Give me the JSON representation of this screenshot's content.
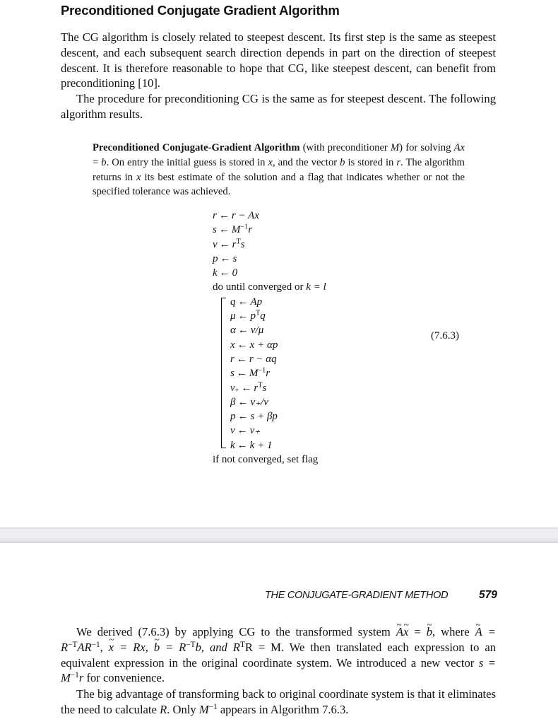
{
  "page_top": {
    "heading": "Preconditioned Conjugate Gradient Algorithm",
    "para1": {
      "text": "The CG algorithm is closely related to steepest descent.  Its first step is the same as steepest descent, and each subsequent search direction depends in part on the direction of steepest descent. It is therefore reasonable to hope that CG, like steepest descent, can benefit from preconditioning [10]."
    },
    "para2": {
      "text": "The procedure for preconditioning CG is the same as for steepest descent.  The following algorithm results."
    },
    "algorithm_box": {
      "title": "Preconditioned Conjugate-Gradient Algorithm",
      "t1": " (with preconditioner ",
      "M": "M",
      "t2": ") for solving ",
      "Ax": "Ax",
      "eq": " = ",
      "b": "b",
      "t3": ". On entry the initial guess is stored in ",
      "x": "x",
      "t4": ", and the vector ",
      "b2": "b",
      "t5": " is stored in ",
      "r": "r",
      "t6": ". The algorithm returns in ",
      "x2": "x",
      "t7": " its best estimate of the solution and a flag that indicates whether or not the specified tolerance was achieved."
    },
    "algorithm": {
      "arrow": "←",
      "init": [
        {
          "lhs": "r",
          "rhs": "r − Ax"
        },
        {
          "lhs": "s",
          "rhs_base": "M",
          "rhs_sup": "−1",
          "rhs_tail": "r"
        },
        {
          "lhs": "ν",
          "rhs_base": "r",
          "rhs_sup": "T",
          "rhs_tail": "s"
        },
        {
          "lhs": "p",
          "rhs": "s"
        },
        {
          "lhs": "k",
          "rhs": "0"
        }
      ],
      "loop_header": "do until converged or ",
      "loop_condition": "k = l",
      "loop": [
        {
          "lhs": "q",
          "rhs": "Ap"
        },
        {
          "lhs": "μ",
          "rhs_base": "p",
          "rhs_sup": "T",
          "rhs_tail": "q"
        },
        {
          "lhs": "α",
          "rhs": "ν/μ"
        },
        {
          "lhs": "x",
          "rhs": "x + αp"
        },
        {
          "lhs": "r",
          "rhs": "r − αq"
        },
        {
          "lhs": "s",
          "rhs_base": "M",
          "rhs_sup": "−1",
          "rhs_tail": "r"
        },
        {
          "lhs": "ν",
          "lhs_sub": "+",
          "rhs_base": "r",
          "rhs_sup": "T",
          "rhs_tail": "s"
        },
        {
          "lhs": "β",
          "rhs": "ν₊/ν"
        },
        {
          "lhs": "p",
          "rhs": "s + βp"
        },
        {
          "lhs": "ν",
          "rhs": "ν₊"
        },
        {
          "lhs": "k",
          "rhs": "k + 1"
        }
      ],
      "footer": "if not converged, set flag",
      "equation_number": "(7.6.3)"
    }
  },
  "page_bottom": {
    "running_head": "THE CONJUGATE-GRADIENT METHOD",
    "page_number": "579",
    "para3": {
      "a": "We derived (7.6.3) by applying CG to the transformed system ",
      "A": "A",
      "x": "x",
      "eq1": " = ",
      "b": "b",
      "b_": ", where ",
      "A2": "A",
      "c": " = R",
      "c_sup": "−T",
      "d": "AR",
      "d_sup": "−1",
      "e": ", ",
      "x2": "x",
      "f": " = Rx, ",
      "b2": "b",
      "g": " = R",
      "g_sup": "−T",
      "h": "b, and R",
      "h_sup": "T",
      "i": "R = M.  We then translated each expression to an equivalent expression in the original coordinate system.  We introduced a new vector ",
      "s": "s",
      "j": " = M",
      "j_sup": "−1",
      "k": "r",
      "l": " for convenience."
    },
    "para4": {
      "a": "The big advantage of transforming back to original coordinate system is that it eliminates the need to calculate ",
      "R": "R",
      "b": ". Only ",
      "M": "M",
      "M_sup": "−1",
      "c": " appears in Algorithm 7.6.3."
    }
  }
}
